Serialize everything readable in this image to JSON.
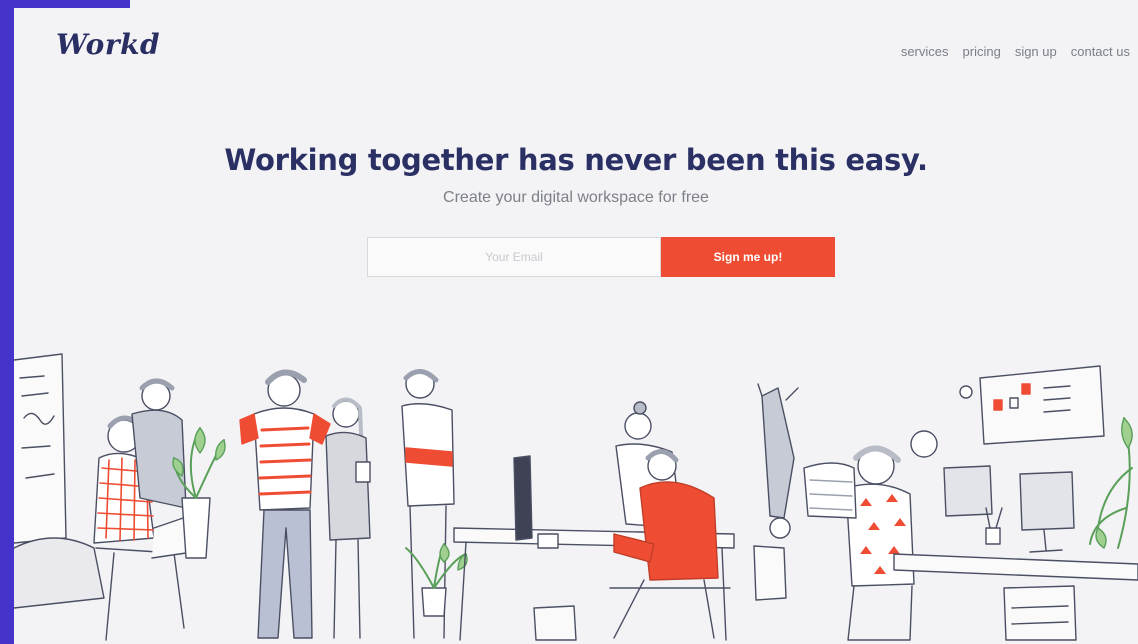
{
  "brand": {
    "logo_text": "Workd",
    "accent": "#ef4d33",
    "frame": "#4633c9",
    "ink": "#2a3064"
  },
  "nav": {
    "items": [
      "services",
      "pricing",
      "sign up",
      "contact us"
    ]
  },
  "hero": {
    "title": "Working together has never been this easy.",
    "subtitle": "Create your digital workspace for free"
  },
  "signup": {
    "placeholder": "Your Email",
    "button_label": "Sign me up!"
  }
}
